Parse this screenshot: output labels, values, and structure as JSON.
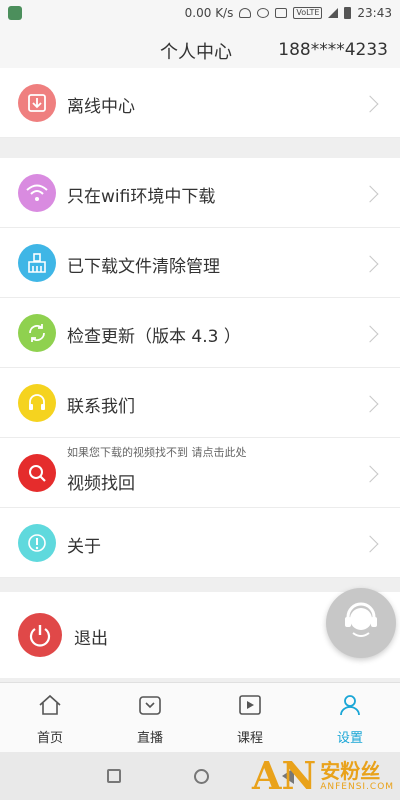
{
  "status_bar": {
    "speed": "0.00 K/s",
    "volte": "VoLTE",
    "time": "23:43"
  },
  "header": {
    "title": "个人中心",
    "phone": "188****4233"
  },
  "menu": {
    "offline": {
      "label": "离线中心",
      "icon": "download-icon",
      "color": "#ef7f7f"
    },
    "wifi": {
      "label": "只在wifi环境中下载",
      "icon": "wifi-icon",
      "color": "#d98be0"
    },
    "clear": {
      "label": "已下载文件清除管理",
      "icon": "broom-icon",
      "color": "#3fb6e6"
    },
    "update": {
      "label": "检查更新（版本  4.3  ）",
      "icon": "refresh-icon",
      "color": "#8fd14f"
    },
    "contact": {
      "label": "联系我们",
      "icon": "headset-icon",
      "color": "#f5d31f"
    },
    "recover": {
      "hint": "如果您下载的视频找不到 请点击此处",
      "label": "视频找回",
      "icon": "search-icon",
      "color": "#e52c2c"
    },
    "about": {
      "label": "关于",
      "icon": "info-icon",
      "color": "#5fd9dd"
    },
    "logout": {
      "label": "退出",
      "icon": "power-icon",
      "color": "#e04848"
    }
  },
  "tabs": [
    {
      "label": "首页",
      "icon": "home-icon"
    },
    {
      "label": "直播",
      "icon": "tv-icon"
    },
    {
      "label": "课程",
      "icon": "play-icon"
    },
    {
      "label": "设置",
      "icon": "person-icon",
      "active": true
    }
  ],
  "watermark": {
    "logo": "AN",
    "cn": "安粉丝",
    "en": "ANFENSI.COM"
  }
}
